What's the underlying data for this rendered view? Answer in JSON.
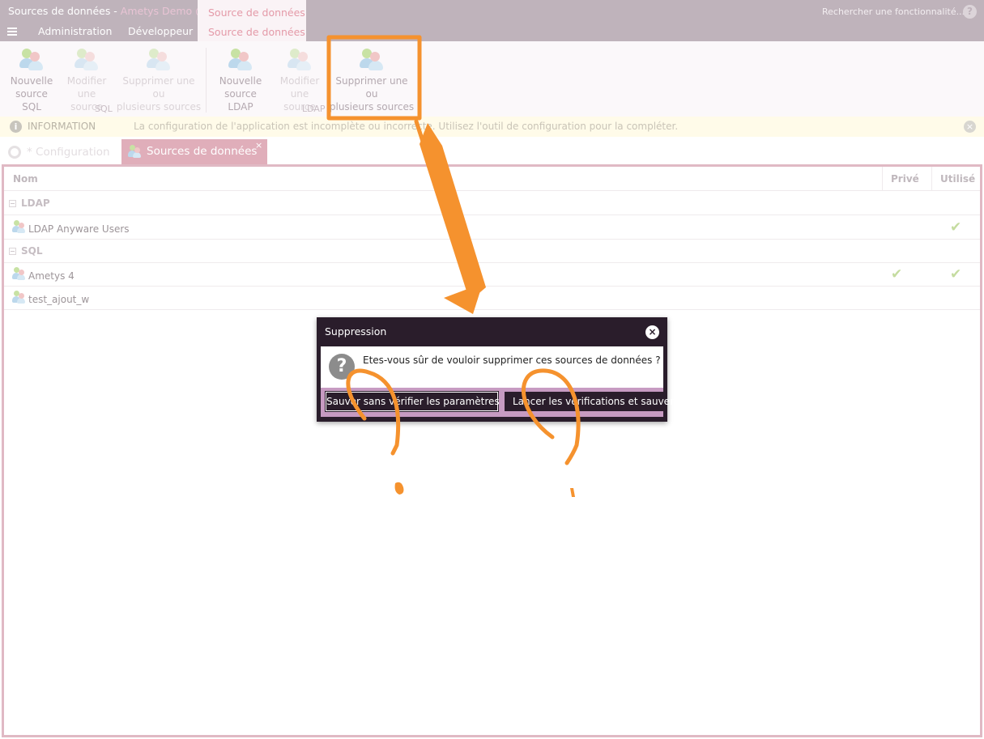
{
  "titlebar": {
    "app_title": "Sources de données - ",
    "app_subtitle": "Ametys Demo @A...",
    "contextual_tab_group": "Source de données",
    "contextual_tab": "Source de données",
    "menu_tabs": [
      "Administration",
      "Développeur"
    ],
    "search_placeholder": "Rechercher une fonctionnalité...",
    "help": "?"
  },
  "ribbon": {
    "sql_group": {
      "label": "SQL",
      "buttons": [
        {
          "label_l1": "Nouvelle",
          "label_l2": "source SQL",
          "enabled": true
        },
        {
          "label_l1": "Modifier",
          "label_l2": "une source",
          "enabled": false
        },
        {
          "label_l1": "Supprimer une ou",
          "label_l2": "plusieurs sources",
          "enabled": false
        }
      ]
    },
    "ldap_group": {
      "label": "LDAP",
      "buttons": [
        {
          "label_l1": "Nouvelle",
          "label_l2": "source LDAP",
          "enabled": true
        },
        {
          "label_l1": "Modifier",
          "label_l2": "une source",
          "enabled": false
        },
        {
          "label_l1": "Supprimer une ou",
          "label_l2": "plusieurs sources",
          "enabled": true
        }
      ]
    }
  },
  "infobar": {
    "label": "INFORMATION",
    "message": "La configuration de l'application est incomplète ou incorrecte. Utilisez l'outil de configuration pour la compléter.",
    "close": "×"
  },
  "tabs": {
    "config": "* Configuration",
    "datasources": "Sources de données",
    "close": "×"
  },
  "grid": {
    "columns": [
      "Nom",
      "Privé",
      "Utilisé"
    ],
    "groups": [
      {
        "name": "LDAP",
        "rows": [
          {
            "name": "LDAP Anyware Users",
            "private": false,
            "used": true
          }
        ]
      },
      {
        "name": "SQL",
        "rows": [
          {
            "name": "Ametys 4",
            "private": true,
            "used": true
          },
          {
            "name": "test_ajout_w",
            "private": false,
            "used": false
          }
        ]
      }
    ],
    "check_glyph": "✔"
  },
  "dialog": {
    "title": "Suppression",
    "close": "×",
    "icon": "?",
    "message": "Etes-vous sûr de vouloir supprimer ces sources de données ?",
    "button_save_no_check": "Sauver sans vérifier les paramètres",
    "button_check_and_save": "Lancer les vérifications et sauver"
  },
  "annotation": {
    "color": "#f5922e"
  }
}
